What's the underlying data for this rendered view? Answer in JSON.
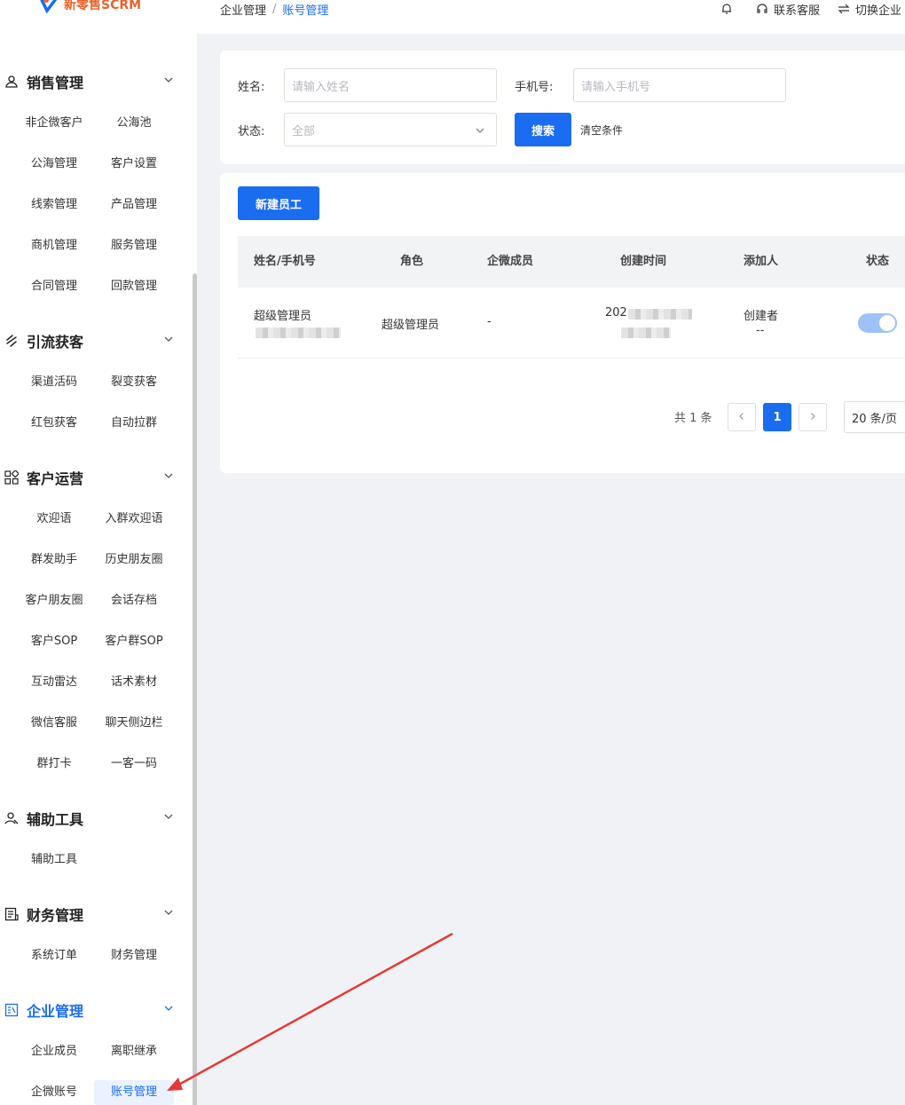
{
  "app": {
    "logo_text": "新零售SCRM"
  },
  "breadcrumb": {
    "first": "企业管理",
    "separator": "/",
    "current": "账号管理"
  },
  "top_actions": {
    "contact": "联系客服",
    "switch": "切换企业"
  },
  "sidebar": {
    "groups": [
      {
        "title": "销售管理",
        "icon": "user-group-icon",
        "items": [
          "非企微客户",
          "公海池",
          "公海管理",
          "客户设置",
          "线索管理",
          "产品管理",
          "商机管理",
          "服务管理",
          "合同管理",
          "回款管理"
        ]
      },
      {
        "title": "引流获客",
        "icon": "flow-icon",
        "items": [
          "渠道活码",
          "裂变获客",
          "红包获客",
          "自动拉群"
        ]
      },
      {
        "title": "客户运营",
        "icon": "grid-icon",
        "items": [
          "欢迎语",
          "入群欢迎语",
          "群发助手",
          "历史朋友圈",
          "客户朋友圈",
          "会话存档",
          "客户SOP",
          "客户群SOP",
          "互动雷达",
          "话术素材",
          "微信客服",
          "聊天侧边栏",
          "群打卡",
          "一客一码"
        ]
      },
      {
        "title": "辅助工具",
        "icon": "tool-user-icon",
        "items": [
          "辅助工具"
        ]
      },
      {
        "title": "财务管理",
        "icon": "finance-icon",
        "items": [
          "系统订单",
          "财务管理"
        ]
      },
      {
        "title": "企业管理",
        "icon": "enterprise-icon",
        "items": [
          "企业成员",
          "离职继承",
          "企微账号",
          "账号管理"
        ]
      }
    ]
  },
  "search_form": {
    "name_label": "姓名:",
    "name_placeholder": "请输入姓名",
    "phone_label": "手机号:",
    "phone_placeholder": "请输入手机号",
    "status_label": "状态:",
    "status_value": "全部",
    "search_button": "搜索",
    "clear_link": "清空条件"
  },
  "table": {
    "new_button": "新建员工",
    "columns": [
      "姓名/手机号",
      "角色",
      "企微成员",
      "创建时间",
      "添加人",
      "状态"
    ],
    "rows": [
      {
        "name": "超级管理员",
        "role": "超级管理员",
        "wecom_member": "-",
        "created_prefix": "202",
        "adder": "创建者",
        "adder_sub": "--",
        "status_on": true
      }
    ]
  },
  "pagination": {
    "total": "共 1 条",
    "current_page": "1",
    "page_size": "20 条/页"
  },
  "colors": {
    "accent": "#1a6cf0",
    "logo": "#e8632c",
    "annotation_arrow": "#e53935"
  }
}
